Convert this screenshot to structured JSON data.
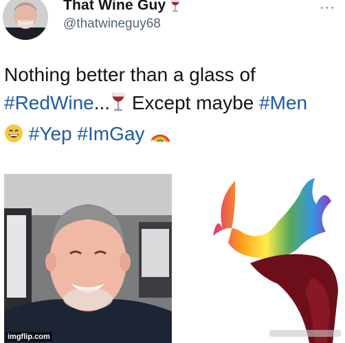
{
  "post": {
    "display_name": "That Wine Guy",
    "name_emoji": "wine-glass-icon",
    "handle": "@thatwineguy68",
    "more_label": "···",
    "text": {
      "line1": "Nothing better than a glass of",
      "hashtag_redwine": "#RedWine",
      "ellipsis": "...",
      "except": " Except maybe ",
      "hashtag_men": "#Men",
      "hashtag_yep": "#Yep",
      "hashtag_imgay": "#ImGay"
    },
    "emojis": [
      "wine-glass-icon",
      "grinning-face-icon",
      "rainbow-icon"
    ]
  },
  "media": {
    "left": "selfie-photo",
    "right": "rainbow-wine-splash",
    "watermark": "imgflip.com"
  },
  "colors": {
    "hashtag": "#1d5aa7",
    "handle": "#536471",
    "text": "#0f1419"
  }
}
